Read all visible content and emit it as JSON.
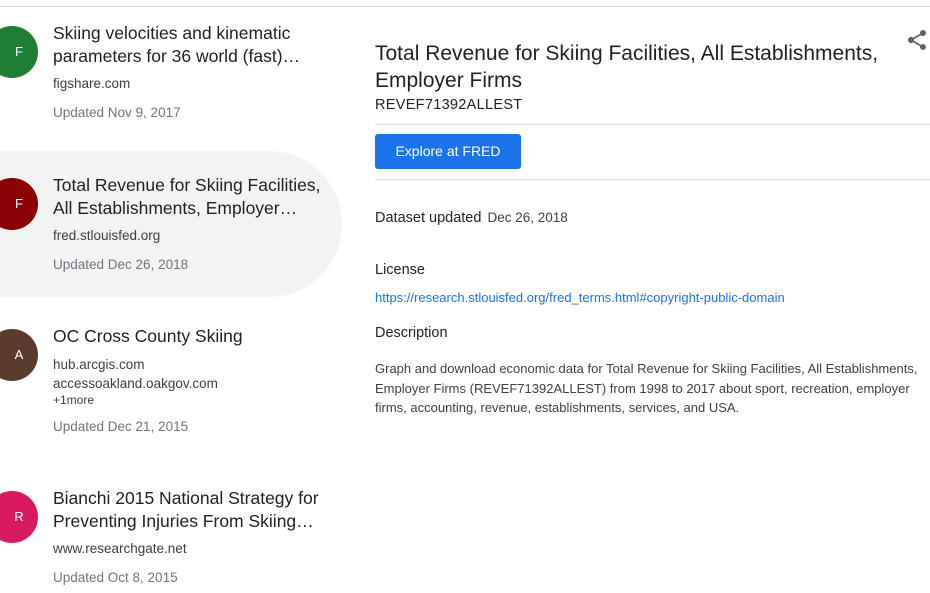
{
  "results": [
    {
      "avatar_letter": "F",
      "avatar_color": "#1e7e34",
      "title": "Skiing velocities and kinematic parameters for 36 world (fast)…",
      "sources": [
        "figshare.com"
      ],
      "more": "",
      "updated": "Updated Nov 9, 2017"
    },
    {
      "avatar_letter": "F",
      "avatar_color": "#8b0000",
      "title": "Total Revenue for Skiing Facilities, All Establishments, Employer…",
      "sources": [
        "fred.stlouisfed.org"
      ],
      "more": "",
      "updated": "Updated Dec 26, 2018",
      "selected": true
    },
    {
      "avatar_letter": "A",
      "avatar_color": "#5d3a2e",
      "title": "OC Cross County Skiing",
      "sources": [
        "hub.arcgis.com",
        "accessoakland.oakgov.com"
      ],
      "more": "+1more",
      "updated": "Updated Dec 21, 2015"
    },
    {
      "avatar_letter": "R",
      "avatar_color": "#d81b60",
      "title": "Bianchi 2015 National Strategy for Preventing Injuries From Skiing…",
      "sources": [
        "www.researchgate.net"
      ],
      "more": "",
      "updated": "Updated Oct 8, 2015"
    }
  ],
  "detail": {
    "title": "Total Revenue for Skiing Facilities, All Establishments, Employer Firms",
    "series_id": "REVEF71392ALLEST",
    "explore_label": "Explore at FRED",
    "dataset_updated_label": "Dataset updated",
    "dataset_updated_value": "Dec 26, 2018",
    "license_heading": "License",
    "license_url": "https://research.stlouisfed.org/fred_terms.html#copyright-public-domain",
    "description_heading": "Description",
    "description": "Graph and download economic data for Total Revenue for Skiing Facilities, All Establishments, Employer Firms (REVEF71392ALLEST) from 1998 to 2017 about sport, recreation, employer firms, accounting, revenue, establishments, services, and USA."
  },
  "icons": {
    "share": "share-icon"
  },
  "colors": {
    "accent": "#1a73e8",
    "selected_bg": "#f1f3f4"
  }
}
